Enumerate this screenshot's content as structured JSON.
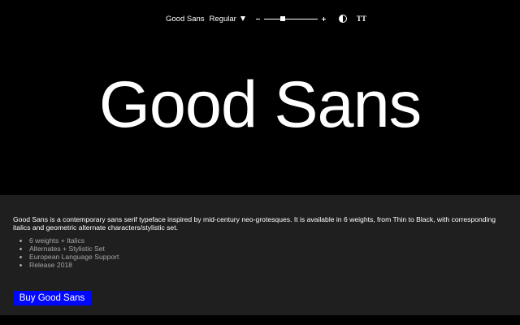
{
  "toolbar": {
    "font_name": "Good Sans",
    "weight": "Regular",
    "size_slider_level": 0.35,
    "icons": {
      "weight_dropdown": "caret-down-icon",
      "decrease": "minus-icon",
      "increase": "plus-icon",
      "theme_toggle": "contrast-icon",
      "case_toggle": "text-case-icon"
    },
    "case_toggle_text": "TT"
  },
  "specimen": {
    "text": "Good Sans"
  },
  "info": {
    "description": "Good Sans is a contemporary sans serif typeface inspired by mid-century neo-grotesques. It is available in 6 weights, from Thin to Black, with corresponding italics and geometric alternate characters/stylistic set.",
    "features": [
      "6 weights + Italics",
      "Alternates + Stylistic Set",
      "European Language Support",
      "Release 2018"
    ],
    "buy_label": "Buy Good Sans"
  },
  "colors": {
    "background": "#000000",
    "panel": "#1f1f1f",
    "text": "#ffffff",
    "muted_text": "#a6a6a6",
    "accent": "#0007ff"
  }
}
